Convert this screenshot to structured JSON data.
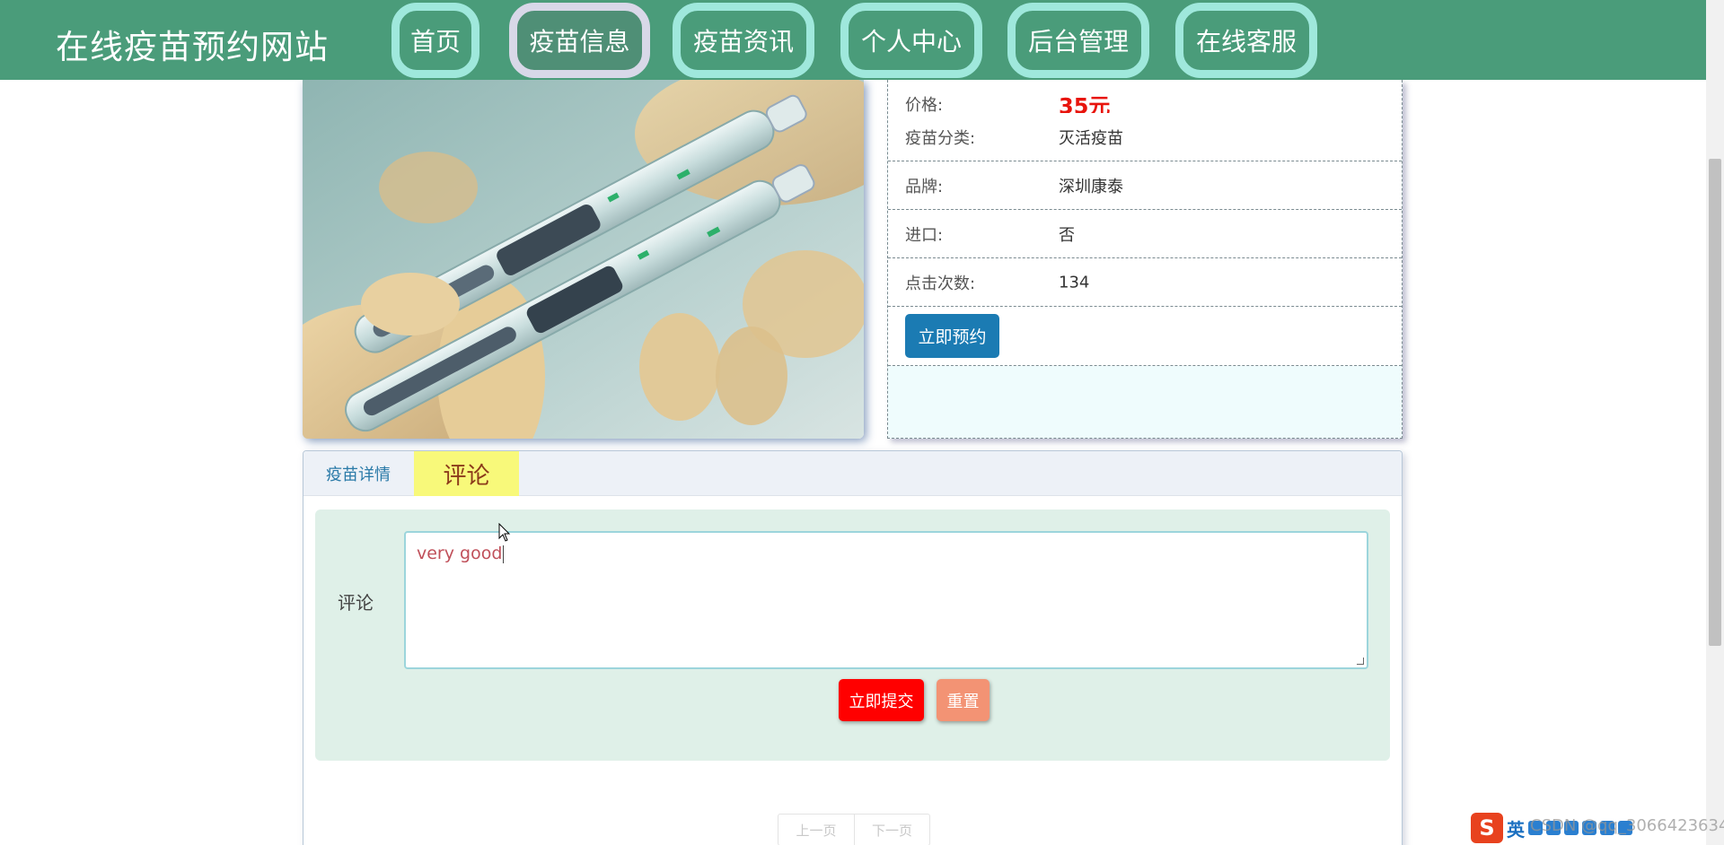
{
  "header": {
    "site_title": "在线疫苗预约网站",
    "nav": [
      {
        "label": "首页",
        "active": false
      },
      {
        "label": "疫苗信息",
        "active": true
      },
      {
        "label": "疫苗资讯",
        "active": false
      },
      {
        "label": "个人中心",
        "active": false
      },
      {
        "label": "后台管理",
        "active": false
      },
      {
        "label": "在线客服",
        "active": false
      }
    ]
  },
  "product": {
    "image_alt": "vaccine-syringes-photo",
    "details": [
      {
        "label": "价格:",
        "value": "35元"
      },
      {
        "label": "疫苗分类:",
        "value": "灭活疫苗"
      },
      {
        "label": "品牌:",
        "value": "深圳康泰"
      },
      {
        "label": "进口:",
        "value": "否"
      },
      {
        "label": "点击次数:",
        "value": "134"
      }
    ],
    "book_label": "立即预约"
  },
  "tabs": {
    "details_label": "疫苗详情",
    "comment_label": "评论"
  },
  "comment_form": {
    "field_label": "评论",
    "textarea_value": "very good",
    "submit_label": "立即提交",
    "reset_label": "重置"
  },
  "pager": {
    "prev_label": "上一页",
    "next_label": "下一页"
  },
  "overlay": {
    "ime_logo": "S",
    "ime_lang": "英",
    "watermark": "CSDN @qq_3066423634"
  },
  "colors": {
    "header_bg": "#4a9c7a",
    "nav_border": "#9fe8dc",
    "price": "#e8140c",
    "book_button": "#1b7bb3",
    "submit_button": "#ff0000",
    "reset_button": "#f39374",
    "active_tab": "#f8f97a"
  }
}
